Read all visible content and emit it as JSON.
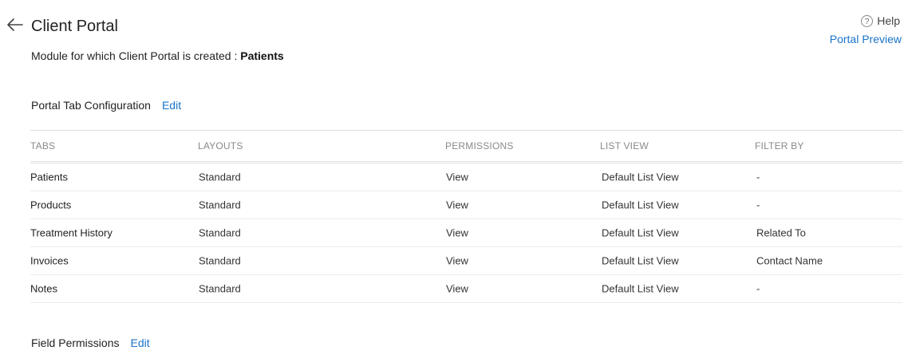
{
  "header": {
    "title": "Client Portal",
    "help_label": "Help",
    "help_icon": "?",
    "portal_preview_label": "Portal Preview"
  },
  "module": {
    "prefix": "Module for which Client Portal is created : ",
    "name": "Patients"
  },
  "portal_tab_config": {
    "title": "Portal Tab Configuration",
    "edit_label": "Edit",
    "columns": [
      "TABS",
      "LAYOUTS",
      "PERMISSIONS",
      "LIST VIEW",
      "FILTER BY"
    ],
    "rows": [
      [
        "Patients",
        "Standard",
        "View",
        "Default List View",
        "-"
      ],
      [
        "Products",
        "Standard",
        "View",
        "Default List View",
        "-"
      ],
      [
        "Treatment History",
        "Standard",
        "View",
        "Default List View",
        "Related To"
      ],
      [
        "Invoices",
        "Standard",
        "View",
        "Default List View",
        "Contact Name"
      ],
      [
        "Notes",
        "Standard",
        "View",
        "Default List View",
        "-"
      ]
    ]
  },
  "field_permissions": {
    "title": "Field Permissions",
    "edit_label": "Edit"
  },
  "colors": {
    "link": "#1a73c8",
    "header_text": "#8a8a8a"
  }
}
